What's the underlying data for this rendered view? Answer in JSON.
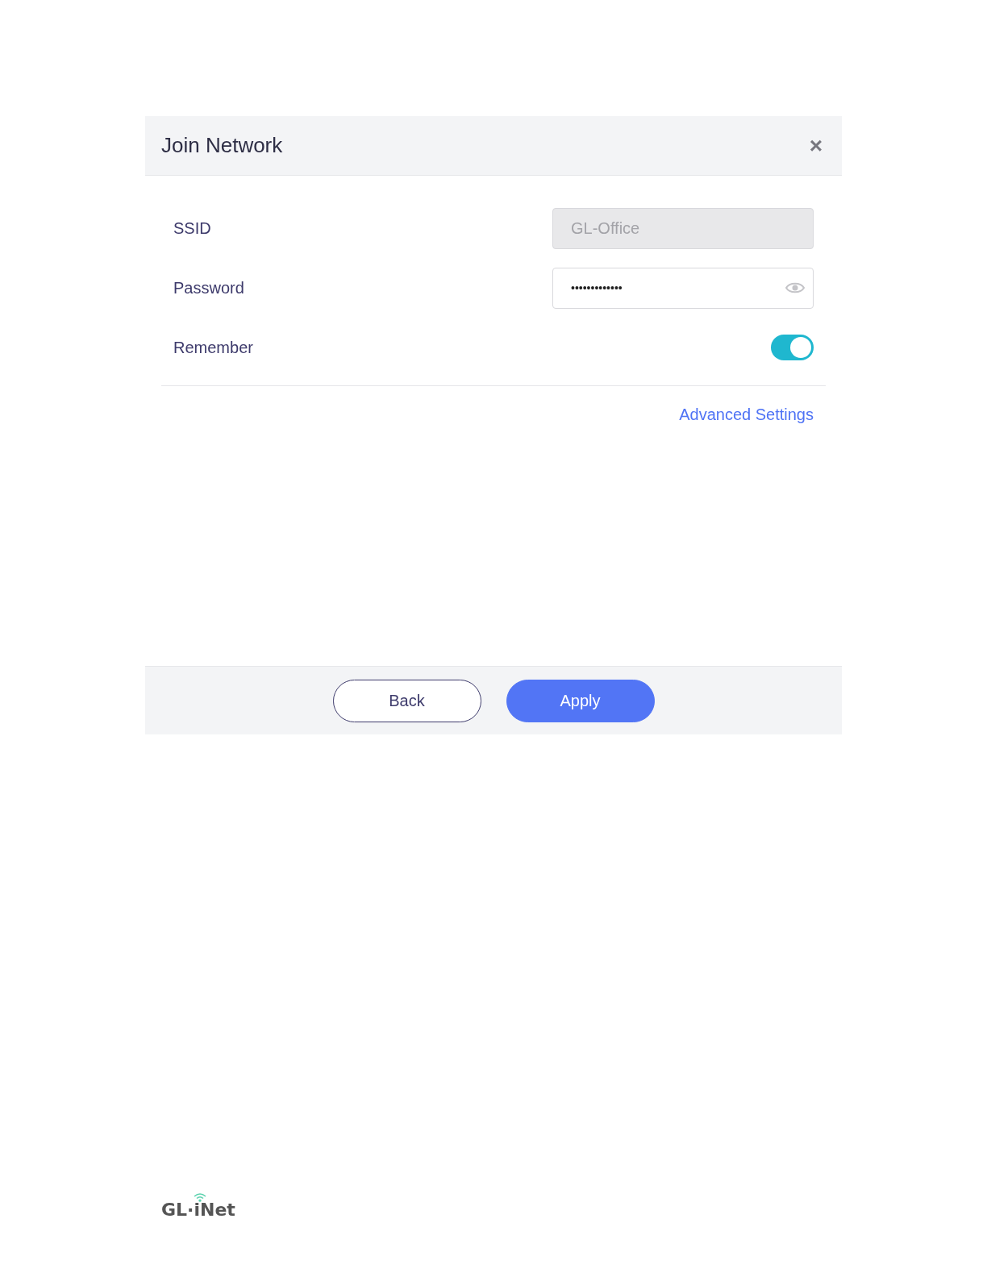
{
  "dialog": {
    "title": "Join Network",
    "close": "×"
  },
  "fields": [
    {
      "kind": "text",
      "label": "SSID",
      "value": "GL-Office",
      "disabled": true
    },
    {
      "kind": "password",
      "label": "Password",
      "value": "•••••••••••••",
      "disabled": false
    },
    {
      "kind": "toggle",
      "label": "Remember",
      "on": true
    }
  ],
  "link": "Advanced Settings",
  "buttons": [
    {
      "label": "Back",
      "primary": false
    },
    {
      "label": "Apply",
      "primary": true
    }
  ],
  "logo": "GL·iNet"
}
